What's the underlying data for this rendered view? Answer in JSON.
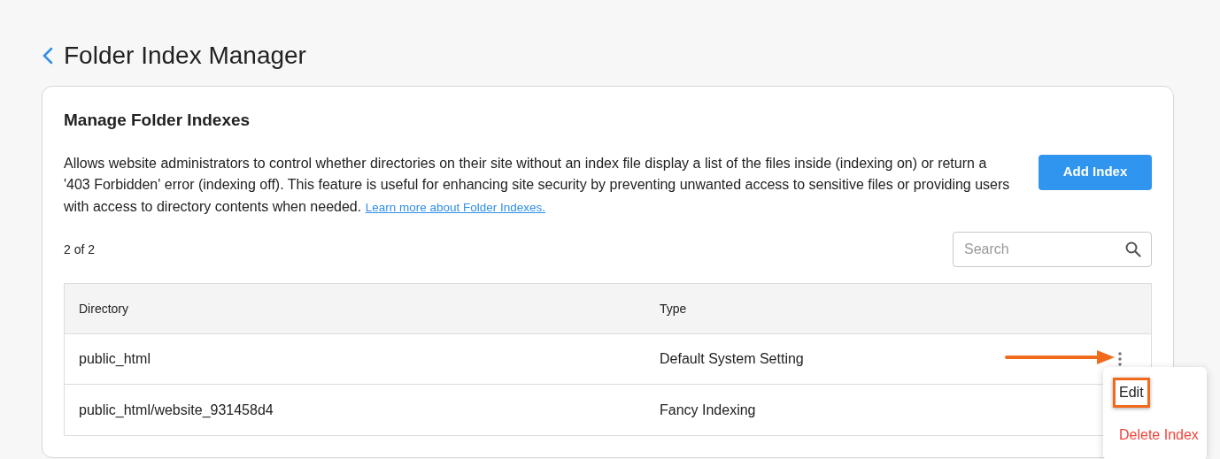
{
  "page": {
    "title": "Folder Index Manager"
  },
  "card": {
    "heading": "Manage Folder Indexes",
    "description": "Allows website administrators to control whether directories on their site without an index file display a list of the files inside (indexing on) or return a '403 Forbidden' error (indexing off). This feature is useful for enhancing site security by preventing unwanted access to sensitive files or providing users with access to directory contents when needed.",
    "link": "Learn more about Folder Indexes.",
    "add_button": "Add Index",
    "count": "2 of 2",
    "search": {
      "placeholder": "Search"
    }
  },
  "table": {
    "columns": [
      "Directory",
      "Type"
    ],
    "rows": [
      {
        "directory": "public_html",
        "type": "Default System Setting",
        "menu_open": true
      },
      {
        "directory": "public_html/website_931458d4",
        "type": "Fancy Indexing"
      }
    ]
  },
  "menu": [
    {
      "label": "Edit",
      "kind": "normal",
      "highlighted": true
    },
    {
      "label": "Delete Index",
      "kind": "danger",
      "highlighted": false
    }
  ]
}
